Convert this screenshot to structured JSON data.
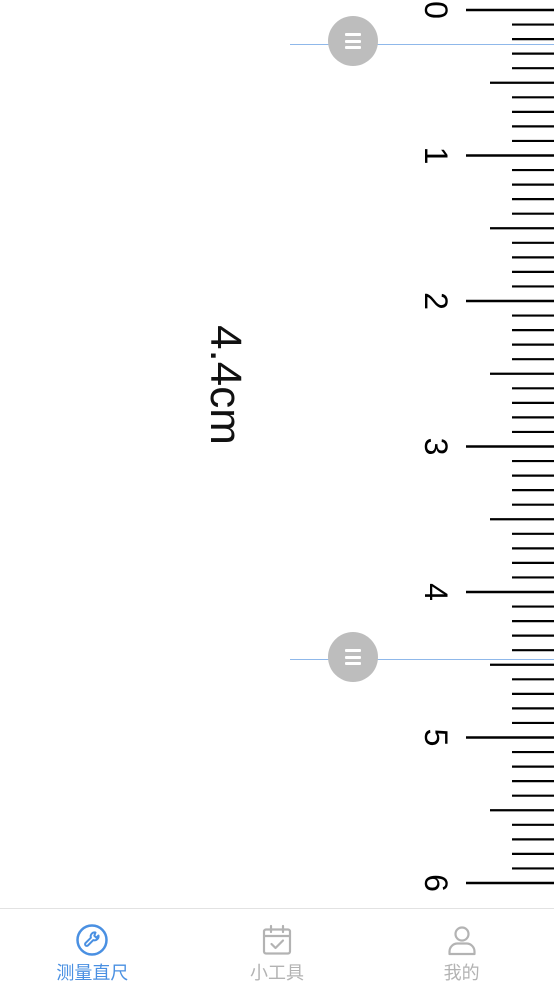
{
  "measurement": {
    "value": "4.4cm"
  },
  "ruler": {
    "unit": "cm",
    "labels": [
      "0",
      "1",
      "2",
      "3",
      "4",
      "5",
      "6"
    ],
    "tick_color": "#000000",
    "guide_color": "#8fb8ea",
    "handle_color": "#bdbdbd"
  },
  "tabbar": {
    "tabs": [
      {
        "label": "测量直尺",
        "icon": "wrench-circle-icon",
        "active": true
      },
      {
        "label": "小工具",
        "icon": "calendar-check-icon",
        "active": false
      },
      {
        "label": "我的",
        "icon": "person-icon",
        "active": false
      }
    ],
    "active_color": "#4a90e2",
    "inactive_color": "#b3b3b3"
  }
}
